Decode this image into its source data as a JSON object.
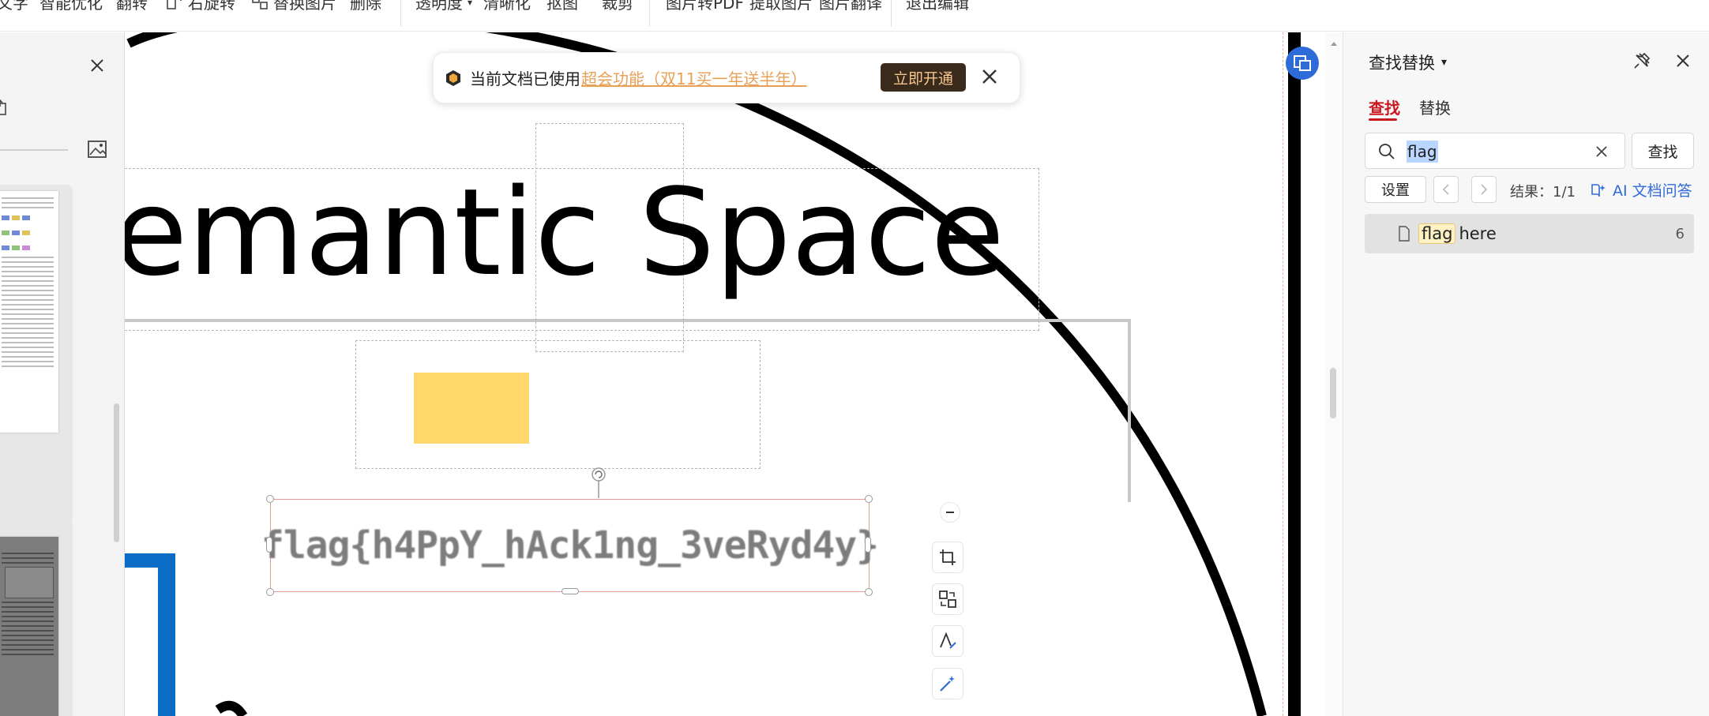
{
  "toolbar": {
    "items": [
      "文字",
      "智能优化",
      "翻转",
      "右旋转",
      "替换图片",
      "删除",
      "透明度",
      "清晰化",
      "抠图",
      "裁剪",
      "图片转PDF",
      "提取图片",
      "图片翻译",
      "退出编辑"
    ]
  },
  "banner": {
    "text": "当前文档已使用",
    "link": "超会功能（双11买一年送半年）",
    "button": "立即开通",
    "logo_color": "#e8a057"
  },
  "slide": {
    "title": "emantic Space",
    "flag_text": "flag{h4PpY_hAck1ng_3veRyd4y}"
  },
  "right_panel": {
    "title": "查找替换",
    "tabs": [
      "查找",
      "替换"
    ],
    "active_tab": "查找",
    "search": {
      "value": "flag",
      "button": "查找"
    },
    "settings_label": "设置",
    "result_text": "结果：1/1",
    "ai_label": "AI 文档问答",
    "results": [
      {
        "match": "flag",
        "rest": "here",
        "count": "6"
      }
    ]
  },
  "colors": {
    "accent_red": "#c8191f",
    "link_blue": "#2f6bd8",
    "banner_button": "#3a2a1c",
    "yellow_rect": "#ffd76a",
    "blue_shape": "#0a6cc4"
  },
  "icons": [
    "rotate-icon",
    "replace-image-icon",
    "close-icon",
    "pin-icon",
    "search-icon",
    "crop-icon",
    "ai-icon",
    "file-icon",
    "chevron-down-icon"
  ]
}
